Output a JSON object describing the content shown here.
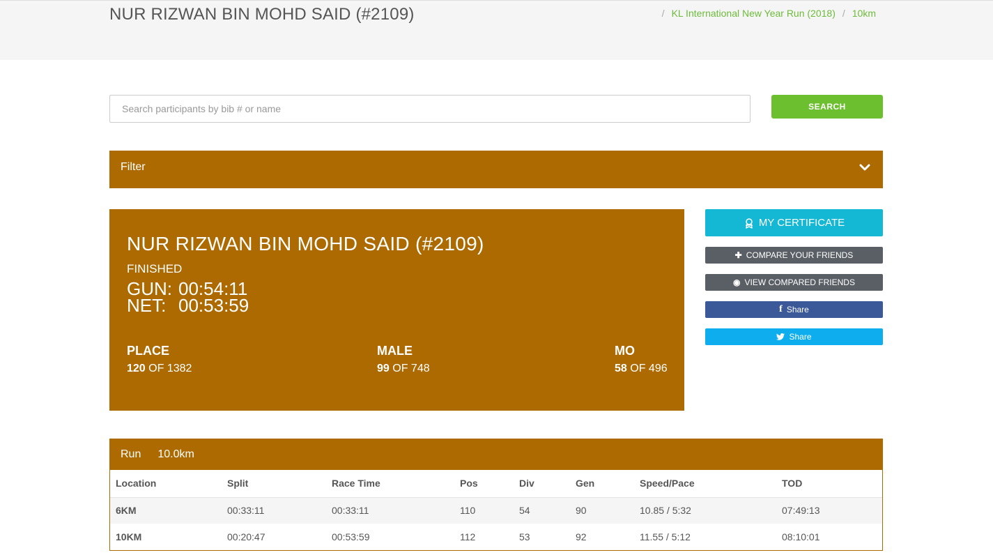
{
  "header": {
    "title": "NUR RIZWAN BIN MOHD SAID (#2109)",
    "breadcrumb": [
      "KL International New Year Run (2018)",
      "10km"
    ]
  },
  "search": {
    "placeholder": "Search participants by bib # or name",
    "value": "",
    "button_label": "SEARCH"
  },
  "filter": {
    "label": "Filter",
    "icon": "chevron-down-icon"
  },
  "result": {
    "name": "NUR RIZWAN BIN MOHD SAID (#2109)",
    "status": "FINISHED",
    "gun_label": "GUN:",
    "gun_time": "00:54:11",
    "net_label": "NET:",
    "net_time": "00:53:59",
    "stats": [
      {
        "title": "PLACE",
        "rank": "120",
        "of": "OF 1382"
      },
      {
        "title": "MALE",
        "rank": "99",
        "of": "OF 748"
      },
      {
        "title": "MO",
        "rank": "58",
        "of": "OF 496"
      }
    ]
  },
  "actions": {
    "certificate": "MY CERTIFICATE",
    "compare": "COMPARE YOUR FRIENDS",
    "view_compared": "VIEW COMPARED FRIENDS",
    "facebook_share": "Share",
    "twitter_share": "Share"
  },
  "splits": {
    "event": "Run",
    "distance": "10.0km",
    "columns": [
      "Location",
      "Split",
      "Race Time",
      "Pos",
      "Div",
      "Gen",
      "Speed/Pace",
      "TOD"
    ],
    "rows": [
      [
        "6KM",
        "00:33:11",
        "00:33:11",
        "110",
        "54",
        "90",
        "10.85 / 5:32",
        "07:49:13"
      ],
      [
        "10KM",
        "00:20:47",
        "00:53:59",
        "112",
        "53",
        "92",
        "11.55 / 5:12",
        "08:10:01"
      ]
    ]
  },
  "colors": {
    "accent_brown": "#ac6a00",
    "search_green": "#6cbf2f",
    "certificate_cyan": "#14b8d4",
    "facebook_blue": "#3b5998",
    "twitter_blue": "#0eadee",
    "gray_button": "#5a5f66"
  }
}
